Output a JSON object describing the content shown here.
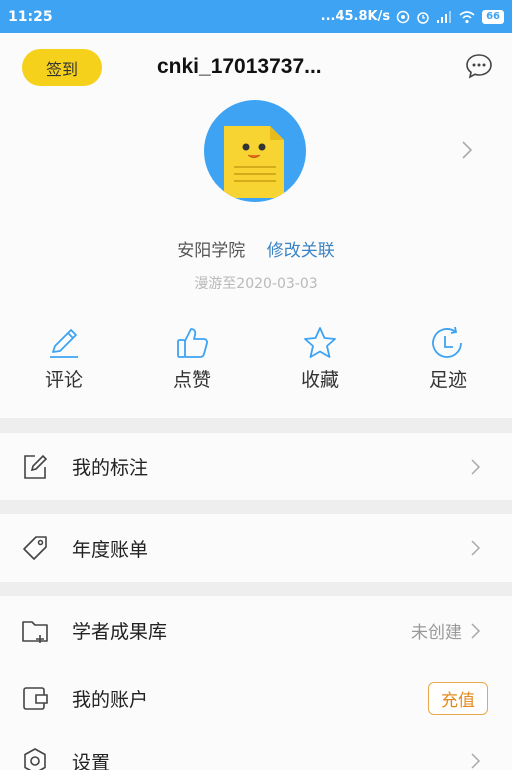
{
  "status_bar": {
    "time": "11:25",
    "network_speed": "...45.8K/s",
    "battery": "66"
  },
  "header": {
    "signin_label": "签到",
    "username": "cnki_17013737...",
    "school": "安阳学院",
    "modify_link": "修改关联",
    "roam_date": "漫游至2020-03-03"
  },
  "actions": [
    {
      "label": "评论",
      "icon": "pencil-icon"
    },
    {
      "label": "点赞",
      "icon": "thumbs-up-icon"
    },
    {
      "label": "收藏",
      "icon": "star-icon"
    },
    {
      "label": "足迹",
      "icon": "clock-history-icon"
    }
  ],
  "menu": [
    {
      "label": "我的标注",
      "icon": "annotation-icon"
    },
    {
      "label": "年度账单",
      "icon": "tag-icon"
    },
    {
      "label": "学者成果库",
      "icon": "folder-plus-icon",
      "status": "未创建"
    },
    {
      "label": "我的账户",
      "icon": "wallet-icon",
      "button": "充值"
    },
    {
      "label": "设置",
      "icon": "settings-icon"
    }
  ],
  "colors": {
    "accent": "#3ea3f2",
    "signin": "#f5d11c",
    "link": "#3b84c6",
    "recharge": "#e48a1d"
  }
}
